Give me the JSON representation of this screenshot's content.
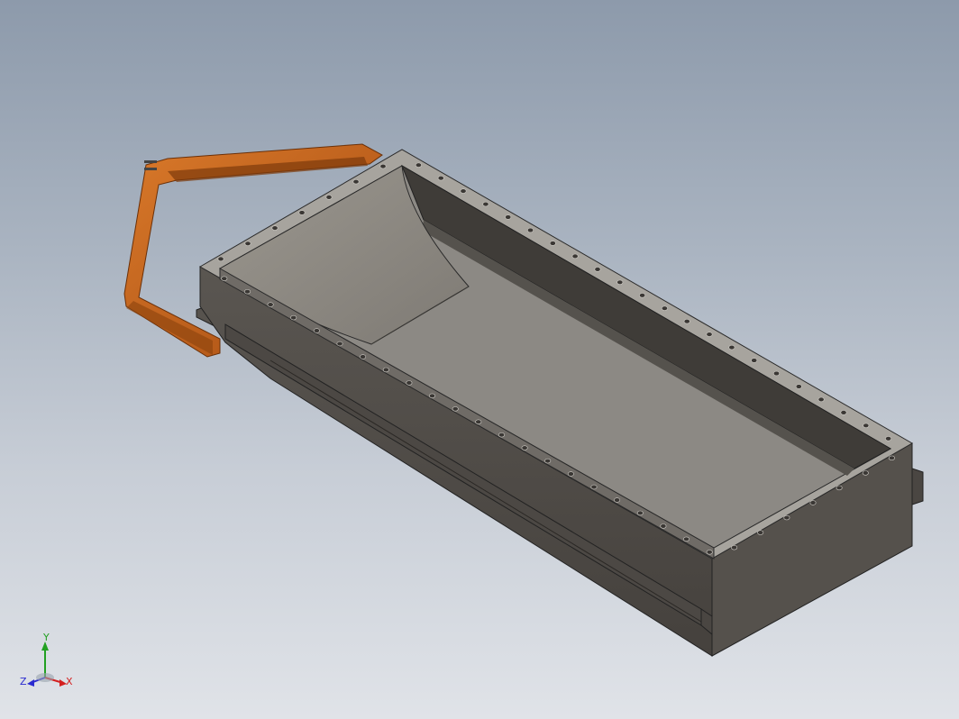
{
  "viewport": {
    "background_top": "#8d9aab",
    "background_bottom": "#e0e3e8"
  },
  "model": {
    "body_color": "#5d5954",
    "inner_color": "#8e8b86",
    "frame_color": "#a6a39d",
    "handle_color": "#c7631b",
    "bolt_holes_near_side": 22,
    "bolt_holes_far_side": 22
  },
  "triad": {
    "x_label": "X",
    "y_label": "Y",
    "z_label": "Z",
    "x_color": "#d42020",
    "y_color": "#22a022",
    "z_color": "#2a2ad0"
  }
}
